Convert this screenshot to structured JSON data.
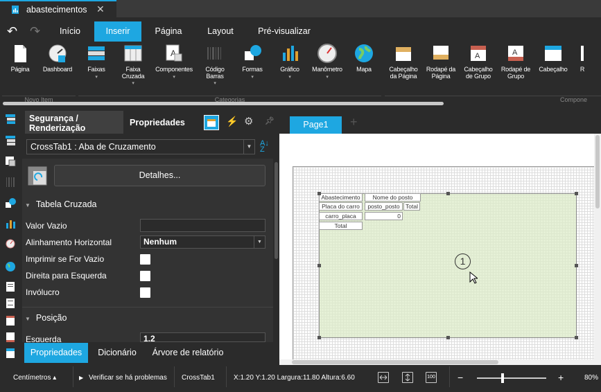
{
  "doc_tab": {
    "title": "abastecimentos",
    "close": "✕"
  },
  "menu": {
    "undo": "↶",
    "redo": "↷",
    "items": [
      "Início",
      "Inserir",
      "Página",
      "Layout",
      "Pré-visualizar"
    ]
  },
  "ribbon": {
    "items": [
      {
        "label": "Página",
        "label2": "",
        "icon": "page-icon"
      },
      {
        "label": "Dashboard",
        "label2": "",
        "icon": "dashboard-icon"
      },
      {
        "label": "Faixas",
        "label2": "",
        "icon": "bands-icon",
        "dropdown": true
      },
      {
        "label": "Faixa",
        "label2": "Cruzada",
        "icon": "cross-band-icon",
        "dropdown": true
      },
      {
        "label": "Componentes",
        "label2": "",
        "icon": "components-icon",
        "dropdown": true
      },
      {
        "label": "Código",
        "label2": "Barras",
        "icon": "barcode-icon",
        "dropdown": true
      },
      {
        "label": "Formas",
        "label2": "",
        "icon": "shapes-icon",
        "dropdown": true
      },
      {
        "label": "Gráfico",
        "label2": "",
        "icon": "chart-icon",
        "dropdown": true
      },
      {
        "label": "Manômetro",
        "label2": "",
        "icon": "gauge-icon",
        "dropdown": true
      },
      {
        "label": "Mapa",
        "label2": "",
        "icon": "map-icon"
      },
      {
        "label": "Cabeçalho",
        "label2": "da Página",
        "icon": "page-header-icon"
      },
      {
        "label": "Rodapé da",
        "label2": "Página",
        "icon": "page-footer-icon"
      },
      {
        "label": "Cabeçalho",
        "label2": "de Grupo",
        "icon": "group-header-icon"
      },
      {
        "label": "Rodapé de",
        "label2": "Grupo",
        "icon": "group-footer-icon"
      },
      {
        "label": "Cabeçalho",
        "label2": "",
        "icon": "header-icon"
      },
      {
        "label": "R",
        "label2": "",
        "icon": "more-icon"
      }
    ],
    "groups": [
      "Novo Item",
      "Categorias",
      "Compone"
    ]
  },
  "panel": {
    "tab_security": "Segurança / Renderização",
    "tab_properties": "Propriedades",
    "component_selector": "CrossTab1 : Aba de Cruzamento",
    "details_button": "Detalhes...",
    "section_crosstab": "Tabela Cruzada",
    "empty_value_label": "Valor Vazio",
    "empty_value": "",
    "halign_label": "Alinhamento Horizontal",
    "halign_value": "Nenhum",
    "print_if_empty_label": "Imprimir se For Vazio",
    "rtl_label": "Direita para Esquerda",
    "wrapper_label": "Invólucro",
    "section_position": "Posição",
    "left_label": "Esquerda",
    "left_value": "1,2"
  },
  "bottom_tabs": [
    "Propriedades",
    "Dicionário",
    "Árvore de relatório"
  ],
  "canvas": {
    "page_tab": "Page1",
    "add_page": "+",
    "band_number": "1",
    "crosstab_cells": {
      "r1c1": "Abastecimento",
      "r1c2": "Nome do posto",
      "r2c1": "Placa do carro",
      "r2c2": "posto_posto",
      "r2c3": "Total",
      "r3c1": "carro_placa",
      "r3c2": "0",
      "r4c1": "Total"
    }
  },
  "status": {
    "units": "Centímetros ▴",
    "check_issues": "Verificar se há problemas",
    "component": "CrossTab1",
    "geometry": "X:1.20 Y:1.20 Largura:11.80 Altura:6.60",
    "zoom_minus": "−",
    "zoom_plus": "+",
    "zoom": "80%",
    "zoom_level": 0.37
  },
  "colors": {
    "accent": "#1ea7e1",
    "background": "#2b2b2b",
    "band": "#e2efd4"
  }
}
